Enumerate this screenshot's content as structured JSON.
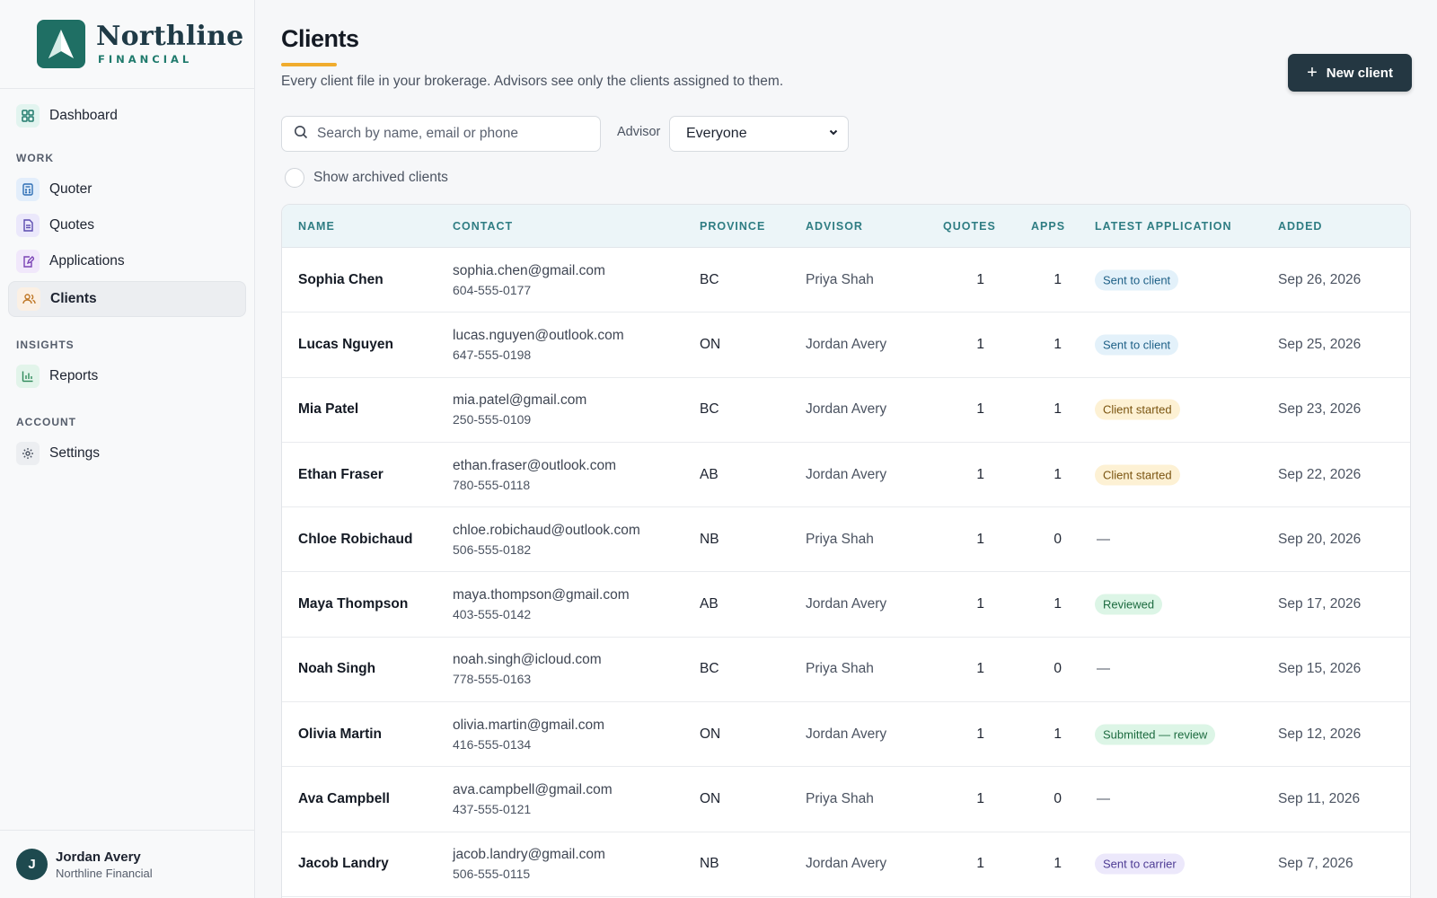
{
  "brand": {
    "name": "Northline",
    "subtitle": "FINANCIAL"
  },
  "sidebar": {
    "dashboard": "Dashboard",
    "sections": {
      "work": "WORK",
      "insights": "INSIGHTS",
      "account": "ACCOUNT"
    },
    "items": {
      "quoter": "Quoter",
      "quotes": "Quotes",
      "applications": "Applications",
      "clients": "Clients",
      "reports": "Reports",
      "settings": "Settings"
    },
    "user": {
      "initial": "J",
      "name": "Jordan Avery",
      "org": "Northline Financial"
    }
  },
  "header": {
    "title": "Clients",
    "description": "Every client file in your brokerage. Advisors see only the clients assigned to them.",
    "new_button": "New client"
  },
  "filters": {
    "search_placeholder": "Search by name, email or phone",
    "advisor_label": "Advisor",
    "advisor_value": "Everyone",
    "archived_label": "Show archived clients"
  },
  "table": {
    "columns": {
      "name": "NAME",
      "contact": "CONTACT",
      "province": "PROVINCE",
      "advisor": "ADVISOR",
      "quotes": "QUOTES",
      "apps": "APPS",
      "latest": "LATEST APPLICATION",
      "added": "ADDED"
    },
    "rows": [
      {
        "name": "Sophia Chen",
        "email": "sophia.chen@gmail.com",
        "phone": "604-555-0177",
        "province": "BC",
        "advisor": "Priya Shah",
        "quotes": "1",
        "apps": "1",
        "latest": "Sent to client",
        "status": "sent-client",
        "added": "Sep 26, 2026"
      },
      {
        "name": "Lucas Nguyen",
        "email": "lucas.nguyen@outlook.com",
        "phone": "647-555-0198",
        "province": "ON",
        "advisor": "Jordan Avery",
        "quotes": "1",
        "apps": "1",
        "latest": "Sent to client",
        "status": "sent-client",
        "added": "Sep 25, 2026"
      },
      {
        "name": "Mia Patel",
        "email": "mia.patel@gmail.com",
        "phone": "250-555-0109",
        "province": "BC",
        "advisor": "Jordan Avery",
        "quotes": "1",
        "apps": "1",
        "latest": "Client started",
        "status": "client-started",
        "added": "Sep 23, 2026"
      },
      {
        "name": "Ethan Fraser",
        "email": "ethan.fraser@outlook.com",
        "phone": "780-555-0118",
        "province": "AB",
        "advisor": "Jordan Avery",
        "quotes": "1",
        "apps": "1",
        "latest": "Client started",
        "status": "client-started",
        "added": "Sep 22, 2026"
      },
      {
        "name": "Chloe Robichaud",
        "email": "chloe.robichaud@outlook.com",
        "phone": "506-555-0182",
        "province": "NB",
        "advisor": "Priya Shah",
        "quotes": "1",
        "apps": "0",
        "latest": "—",
        "status": "none",
        "added": "Sep 20, 2026"
      },
      {
        "name": "Maya Thompson",
        "email": "maya.thompson@gmail.com",
        "phone": "403-555-0142",
        "province": "AB",
        "advisor": "Jordan Avery",
        "quotes": "1",
        "apps": "1",
        "latest": "Reviewed",
        "status": "reviewed",
        "added": "Sep 17, 2026"
      },
      {
        "name": "Noah Singh",
        "email": "noah.singh@icloud.com",
        "phone": "778-555-0163",
        "province": "BC",
        "advisor": "Priya Shah",
        "quotes": "1",
        "apps": "0",
        "latest": "—",
        "status": "none",
        "added": "Sep 15, 2026"
      },
      {
        "name": "Olivia Martin",
        "email": "olivia.martin@gmail.com",
        "phone": "416-555-0134",
        "province": "ON",
        "advisor": "Jordan Avery",
        "quotes": "1",
        "apps": "1",
        "latest": "Submitted — review",
        "status": "submitted",
        "added": "Sep 12, 2026"
      },
      {
        "name": "Ava Campbell",
        "email": "ava.campbell@gmail.com",
        "phone": "437-555-0121",
        "province": "ON",
        "advisor": "Priya Shah",
        "quotes": "1",
        "apps": "0",
        "latest": "—",
        "status": "none",
        "added": "Sep 11, 2026"
      },
      {
        "name": "Jacob Landry",
        "email": "jacob.landry@gmail.com",
        "phone": "506-555-0115",
        "province": "NB",
        "advisor": "Jordan Avery",
        "quotes": "1",
        "apps": "1",
        "latest": "Sent to carrier",
        "status": "sent-carrier",
        "added": "Sep 7, 2026"
      }
    ]
  },
  "status_colors": {
    "sent-client": {
      "bg": "#e3f1fa",
      "fg": "#1d5f86"
    },
    "client-started": {
      "bg": "#fdf1d4",
      "fg": "#7a5410"
    },
    "reviewed": {
      "bg": "#dcf5e6",
      "fg": "#1d6b40"
    },
    "submitted": {
      "bg": "#dcf5e6",
      "fg": "#1d6b40"
    },
    "sent-carrier": {
      "bg": "#ece8fb",
      "fg": "#4d3b94"
    }
  },
  "colors": {
    "accent": "#f0ac2e",
    "brand": "#1f6f64",
    "primary_button": "#243742"
  }
}
